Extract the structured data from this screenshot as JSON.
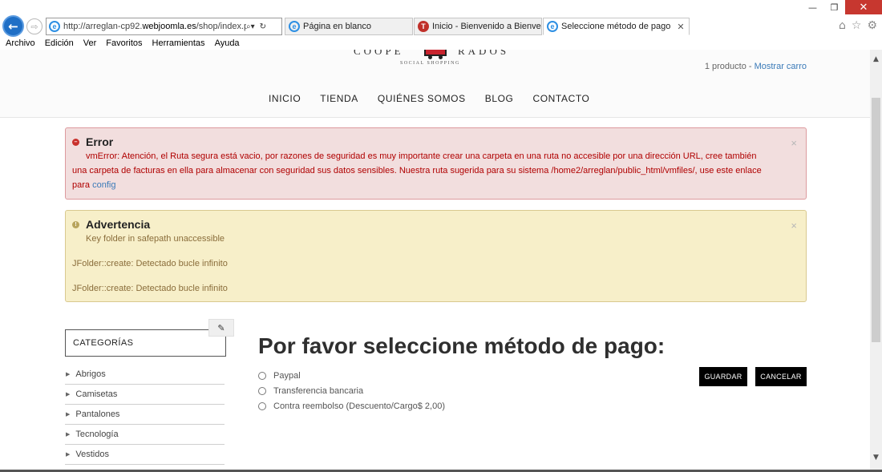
{
  "browser": {
    "url_prefix": "http://arreglan-cp92.",
    "url_domain": "webjoomla.es",
    "url_suffix": "/shop/index.php?o",
    "tabs": [
      {
        "label": "Página en blanco",
        "icon": "ie-icon"
      },
      {
        "label": "Inicio - Bienvenido a Bienvenid...",
        "icon": "t-red-icon"
      },
      {
        "label": "Seleccione método de pago",
        "icon": "ie-icon",
        "active": true
      }
    ],
    "menu": [
      "Archivo",
      "Edición",
      "Ver",
      "Favoritos",
      "Herramientas",
      "Ayuda"
    ],
    "tab_close": "✕"
  },
  "header": {
    "logo_left": "COOPE",
    "logo_right": "RADOS",
    "logo_tag": "SOCIAL SHOPPING",
    "cart_count": "1 producto",
    "cart_sep": " - ",
    "cart_link": "Mostrar carro",
    "nav": [
      "INICIO",
      "TIENDA",
      "QUIÉNES SOMOS",
      "BLOG",
      "CONTACTO"
    ]
  },
  "alerts": {
    "error": {
      "title": "Error",
      "message": "vmError: Atención, el Ruta segura está vacio, por razones de seguridad es muy importante crear una carpeta en una ruta no accesible por una dirección URL, cree también",
      "message_cont": "una carpeta de facturas en ella para almacenar con seguridad sus datos sensibles. Nuestra ruta sugerida para su sistema /home2/arreglan/public_html/vmfiles/, use este enlace",
      "message_end": "para ",
      "link": "config"
    },
    "warning": {
      "title": "Advertencia",
      "subtitle": "Key folder in safepath unaccessible",
      "lines": [
        "JFolder::create: Detectado bucle infinito",
        "JFolder::create: Detectado bucle infinito"
      ]
    },
    "close": "×"
  },
  "sidebar": {
    "title": "CATEGORÍAS",
    "items": [
      "Abrigos",
      "Camisetas",
      "Pantalones",
      "Tecnología",
      "Vestidos"
    ]
  },
  "payment": {
    "title": "Por favor seleccione método de pago:",
    "options": [
      {
        "label": "Paypal",
        "selected": false
      },
      {
        "label": "Transferencia bancaria",
        "selected": false
      },
      {
        "label": "Contra reembolso  (Descuento/Cargo$ 2,00)",
        "selected": false
      }
    ],
    "save_label": "GUARDAR",
    "cancel_label": "CANCELAR"
  }
}
